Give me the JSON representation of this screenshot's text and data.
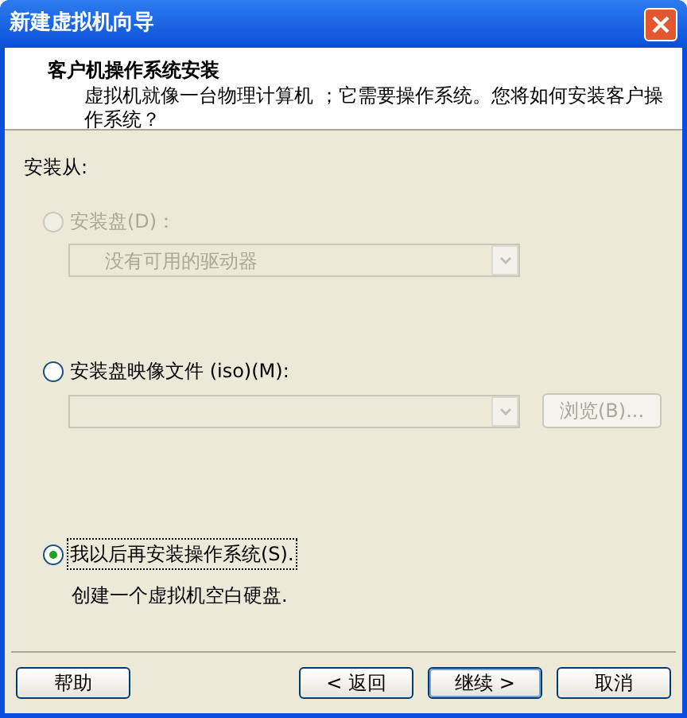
{
  "window": {
    "title": "新建虚拟机向导"
  },
  "header": {
    "title": "客户机操作系统安装",
    "description": "虚拟机就像一台物理计算机 ；它需要操作系统。您将如何安装客户操作系统？"
  },
  "source_label": "安装从:",
  "options": [
    {
      "label": "安装盘(D)：",
      "selected": false,
      "disabled": true,
      "kind": "dropdown",
      "value": "没有可用的驱动器"
    },
    {
      "label": "安装盘映像文件 (iso)(M):",
      "selected": false,
      "disabled": false,
      "kind": "file",
      "browse": "浏览(B)...",
      "field_disabled": true
    },
    {
      "label": "我以后再安装操作系统(S).",
      "selected": true,
      "disabled": false,
      "kind": "note",
      "note": "创建一个虚拟机空白硬盘."
    }
  ],
  "buttons": [
    {
      "label": "帮助"
    },
    {
      "label": "< 返回"
    },
    {
      "label": "继续 >",
      "default": true
    },
    {
      "label": "取消"
    }
  ]
}
